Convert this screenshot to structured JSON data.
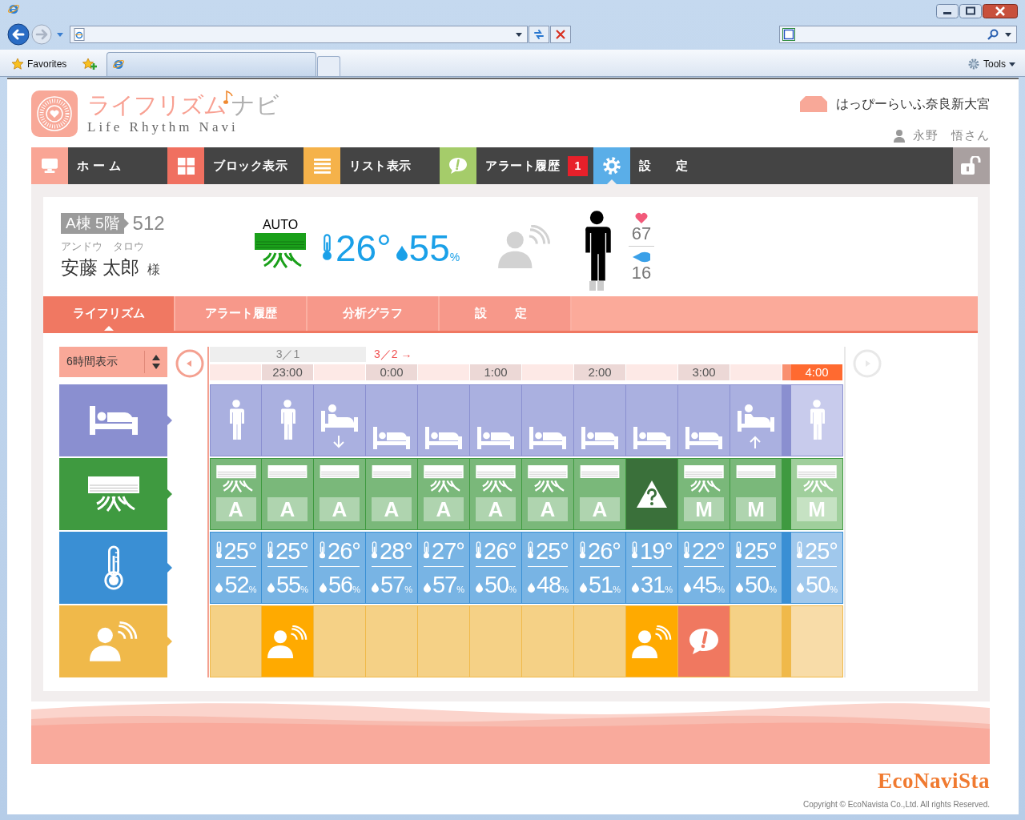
{
  "browser": {
    "favorites": "Favorites",
    "tools": "Tools"
  },
  "app": {
    "title_main": "ライフリズム",
    "title_sub": "ナビ",
    "subtitle": "Life Rhythm Navi",
    "facility": "はっぴーらいふ奈良新大宮",
    "user": "永野　悟さん"
  },
  "nav": [
    {
      "label": "ホ ー ム",
      "kind": "monitor",
      "color": "#f9a595",
      "selected": false
    },
    {
      "label": "ブロック表示",
      "kind": "grid",
      "color": "#f07060",
      "selected": false
    },
    {
      "label": "リスト表示",
      "kind": "list",
      "color": "#f5b24a",
      "selected": false
    },
    {
      "label": "アラート履歴",
      "kind": "alert",
      "color": "#a5cc6a",
      "selected": false,
      "badge": "1"
    },
    {
      "label": "設　定",
      "kind": "gear",
      "color": "#5aaee8",
      "selected": true
    }
  ],
  "patient": {
    "room": "A棟 5階",
    "number": "512",
    "kana": "アンドウ　タロウ",
    "name": "安藤 太郎",
    "honorific": "様",
    "ac": {
      "kind": "blowing",
      "mode": "AUTO"
    },
    "temp": "26°",
    "humidity": "55$_{%}$",
    "presence": {
      "detected": false
    },
    "posture": {
      "kind": "standing"
    },
    "heart_rate": "67",
    "respiration": "16"
  },
  "subtabs": [
    {
      "label": "ライフリズム",
      "selected": true
    },
    {
      "label": "アラート履歴",
      "selected": false
    },
    {
      "label": "分析グラフ",
      "selected": false
    },
    {
      "label": "設　定",
      "selected": false
    }
  ],
  "timeline": {
    "range": "6時間表示",
    "columns": [
      {
        "date": {
          "label": "3／1",
          "kind": "previous"
        },
        "posture": {
          "kind": "standing"
        },
        "ac": {
          "kind": "blowing",
          "mode": "A"
        },
        "temp": "25°",
        "humidity": "52$_{%}$",
        "current": false
      },
      {
        "time": "23:00",
        "posture": {
          "kind": "standing"
        },
        "ac": {
          "kind": "on",
          "mode": "A"
        },
        "temp": "25°",
        "humidity": "55$_{%}$",
        "presence": {
          "kind": "detected"
        },
        "current": false
      },
      {
        "posture": {
          "kind": "bed_in"
        },
        "ac": {
          "kind": "on",
          "mode": "A"
        },
        "temp": "26°",
        "humidity": "56$_{%}$",
        "current": false
      },
      {
        "date": {
          "label": "3／2 →",
          "kind": "next"
        },
        "time": "0:00",
        "posture": {
          "kind": "lying"
        },
        "ac": {
          "kind": "on",
          "mode": "A"
        },
        "temp": "28°",
        "humidity": "57$_{%}$",
        "current": false
      },
      {
        "posture": {
          "kind": "lying"
        },
        "ac": {
          "kind": "blowing",
          "mode": "A"
        },
        "temp": "27°",
        "humidity": "57$_{%}$",
        "current": false
      },
      {
        "time": "1:00",
        "posture": {
          "kind": "lying"
        },
        "ac": {
          "kind": "blowing",
          "mode": "A"
        },
        "temp": "26°",
        "humidity": "50$_{%}$",
        "current": false
      },
      {
        "posture": {
          "kind": "lying"
        },
        "ac": {
          "kind": "blowing",
          "mode": "A"
        },
        "temp": "25°",
        "humidity": "48$_{%}$",
        "current": false
      },
      {
        "time": "2:00",
        "posture": {
          "kind": "lying"
        },
        "ac": {
          "kind": "on",
          "mode": "A"
        },
        "temp": "26°",
        "humidity": "51$_{%}$",
        "current": false
      },
      {
        "posture": {
          "kind": "lying"
        },
        "ac": {
          "kind": "unknown"
        },
        "temp": "19°",
        "humidity": "31$_{%}$",
        "presence": {
          "kind": "detected"
        },
        "current": false
      },
      {
        "time": "3:00",
        "posture": {
          "kind": "lying"
        },
        "ac": {
          "kind": "blowing",
          "mode": "M"
        },
        "temp": "22°",
        "humidity": "45$_{%}$",
        "presence": {
          "kind": "alert"
        },
        "current": false
      },
      {
        "posture": {
          "kind": "bed_out"
        },
        "ac": {
          "kind": "on",
          "mode": "M"
        },
        "temp": "25°",
        "humidity": "50$_{%}$",
        "current": false
      },
      {
        "time": "4:00",
        "posture": {
          "kind": "standing"
        },
        "ac": {
          "kind": "blowing",
          "mode": "M"
        },
        "temp": "25°",
        "humidity": "50$_{%}$",
        "current": true
      }
    ]
  },
  "footer": {
    "brand": "EcoNaviSta",
    "copyright": "Copyright © EcoNavista Co.,Ltd. All rights Reserved."
  }
}
